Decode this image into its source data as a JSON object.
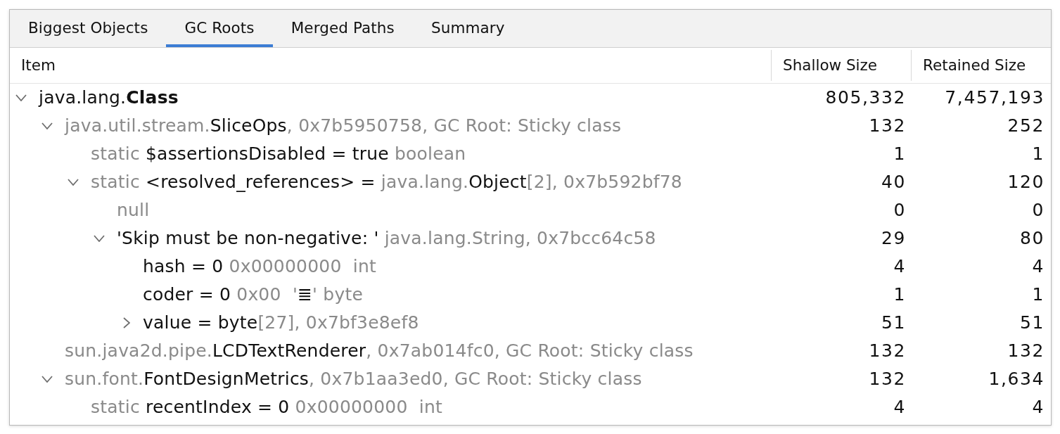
{
  "tabs": [
    {
      "label": "Biggest Objects",
      "selected": false
    },
    {
      "label": "GC Roots",
      "selected": true
    },
    {
      "label": "Merged Paths",
      "selected": false
    },
    {
      "label": "Summary",
      "selected": false
    }
  ],
  "table": {
    "columns": [
      "Item",
      "Shallow Size",
      "Retained Size"
    ],
    "rows": [
      {
        "label": [
          {
            "text": "java.lang.**Class**",
            "dim": false
          }
        ],
        "expanded": true,
        "shallow_size": "805,332",
        "retained_size": "7,457,193",
        "children": [
          {
            "label": [
              {
                "text": "java.util.stream.",
                "dim": true
              },
              {
                "text": "SliceOps",
                "dim": false
              },
              {
                "text": ", 0x7b5950758, GC Root: Sticky class",
                "dim": true
              }
            ],
            "expanded": true,
            "shallow_size": "132",
            "retained_size": "252",
            "children": [
              {
                "label": [
                  {
                    "text": "static ",
                    "dim": true
                  },
                  {
                    "text": "$assertionsDisabled = true",
                    "dim": false
                  },
                  {
                    "text": " boolean",
                    "dim": true
                  }
                ],
                "shallow_size": "1",
                "retained_size": "1"
              },
              {
                "label": [
                  {
                    "text": "static ",
                    "dim": true
                  },
                  {
                    "text": "<resolved_references> = ",
                    "dim": false
                  },
                  {
                    "text": "java.lang.",
                    "dim": true
                  },
                  {
                    "text": "Object",
                    "dim": false
                  },
                  {
                    "text": "[2], 0x7b592bf78",
                    "dim": true
                  }
                ],
                "expanded": true,
                "shallow_size": "40",
                "retained_size": "120",
                "children": [
                  {
                    "label": [
                      {
                        "text": "null",
                        "dim": true
                      }
                    ],
                    "shallow_size": "0",
                    "retained_size": "0"
                  },
                  {
                    "label": [
                      {
                        "text": "'Skip must be non-negative: '",
                        "dim": false
                      },
                      {
                        "text": " java.lang.String, 0x7bcc64c58",
                        "dim": true
                      }
                    ],
                    "expanded": true,
                    "shallow_size": "29",
                    "retained_size": "80",
                    "children": [
                      {
                        "label": [
                          {
                            "text": "hash = 0",
                            "dim": false
                          },
                          {
                            "text": " 0x00000000  int",
                            "dim": true
                          }
                        ],
                        "shallow_size": "4",
                        "retained_size": "4"
                      },
                      {
                        "label": [
                          {
                            "text": "coder = 0",
                            "dim": false
                          },
                          {
                            "text": " 0x00  '",
                            "dim": true
                          },
                          {
                            "text": "≣",
                            "dim": false
                          },
                          {
                            "text": "' byte",
                            "dim": true
                          }
                        ],
                        "shallow_size": "1",
                        "retained_size": "1"
                      },
                      {
                        "label": [
                          {
                            "text": "value = byte",
                            "dim": false
                          },
                          {
                            "text": "[27], 0x7bf3e8ef8",
                            "dim": true
                          }
                        ],
                        "expanded": false,
                        "shallow_size": "51",
                        "retained_size": "51"
                      }
                    ]
                  }
                ]
              }
            ]
          },
          {
            "label": [
              {
                "text": "sun.java2d.pipe.",
                "dim": true
              },
              {
                "text": "LCDTextRenderer",
                "dim": false
              },
              {
                "text": ", 0x7ab014fc0, GC Root: Sticky class",
                "dim": true
              }
            ],
            "shallow_size": "132",
            "retained_size": "132"
          },
          {
            "label": [
              {
                "text": "sun.font.",
                "dim": true
              },
              {
                "text": "FontDesignMetrics",
                "dim": false
              },
              {
                "text": ", 0x7b1aa3ed0, GC Root: Sticky class",
                "dim": true
              }
            ],
            "expanded": true,
            "shallow_size": "132",
            "retained_size": "1,634",
            "children": [
              {
                "label": [
                  {
                    "text": "static ",
                    "dim": true
                  },
                  {
                    "text": "recentIndex = 0",
                    "dim": false
                  },
                  {
                    "text": " 0x00000000  int",
                    "dim": true
                  }
                ],
                "shallow_size": "4",
                "retained_size": "4"
              }
            ]
          }
        ]
      }
    ]
  }
}
